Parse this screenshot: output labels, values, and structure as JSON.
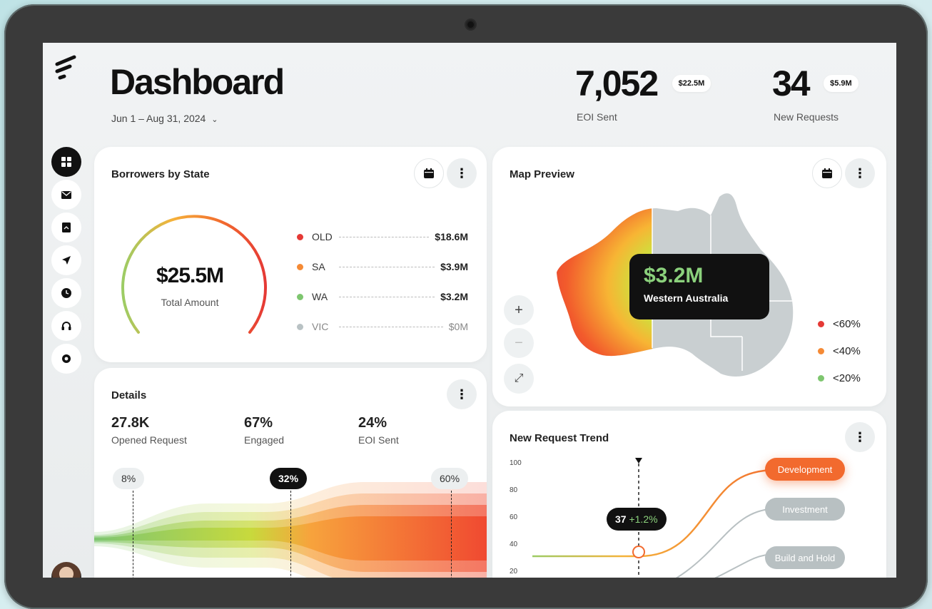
{
  "header": {
    "title": "Dashboard",
    "date_range": "Jun 1 – Aug 31, 2024",
    "kpis": [
      {
        "value": "7,052",
        "badge": "$22.5M",
        "label": "EOI Sent"
      },
      {
        "value": "34",
        "badge": "$5.9M",
        "label": "New Requests"
      }
    ]
  },
  "sidebar": {
    "items": [
      {
        "name": "dashboard",
        "icon": "grid-icon",
        "active": true
      },
      {
        "name": "mail",
        "icon": "mail-icon"
      },
      {
        "name": "reports",
        "icon": "document-icon"
      },
      {
        "name": "send",
        "icon": "send-icon"
      },
      {
        "name": "history",
        "icon": "clock-icon"
      },
      {
        "name": "support",
        "icon": "headset-icon"
      },
      {
        "name": "settings",
        "icon": "settings-icon"
      }
    ]
  },
  "borrowers": {
    "title": "Borrowers by State",
    "total": "$25.5M",
    "total_label": "Total Amount",
    "states": [
      {
        "name": "OLD",
        "value": "$18.6M",
        "color": "#e53935"
      },
      {
        "name": "SA",
        "value": "$3.9M",
        "color": "#f58a35"
      },
      {
        "name": "WA",
        "value": "$3.2M",
        "color": "#7ec66f"
      },
      {
        "name": "VIC",
        "value": "$0M",
        "color": "#b9c2c4"
      }
    ]
  },
  "details": {
    "title": "Details",
    "stats": [
      {
        "value": "27.8K",
        "label": "Opened Request"
      },
      {
        "value": "67%",
        "label": "Engaged"
      },
      {
        "value": "24%",
        "label": "EOI Sent"
      }
    ],
    "markers": [
      "8%",
      "32%",
      "60%"
    ]
  },
  "map": {
    "title": "Map Preview",
    "tooltip_value": "$3.2M",
    "tooltip_label": "Western Australia",
    "zoom_in": "+",
    "zoom_out": "−",
    "expand": "⤢",
    "legend": [
      {
        "label": "<60%",
        "color": "#e53935"
      },
      {
        "label": "<40%",
        "color": "#f58a35"
      },
      {
        "label": "<20%",
        "color": "#7ec66f"
      }
    ]
  },
  "trend": {
    "title": "New Request Trend",
    "y_ticks": [
      "100",
      "80",
      "60",
      "40",
      "20"
    ],
    "tooltip_value": "37",
    "tooltip_delta": "+1.2%",
    "series": [
      {
        "name": "Development",
        "color": "#f26a2e"
      },
      {
        "name": "Investment",
        "color": "#b8c0c2"
      },
      {
        "name": "Build and Hold",
        "color": "#b8c0c2"
      }
    ]
  }
}
